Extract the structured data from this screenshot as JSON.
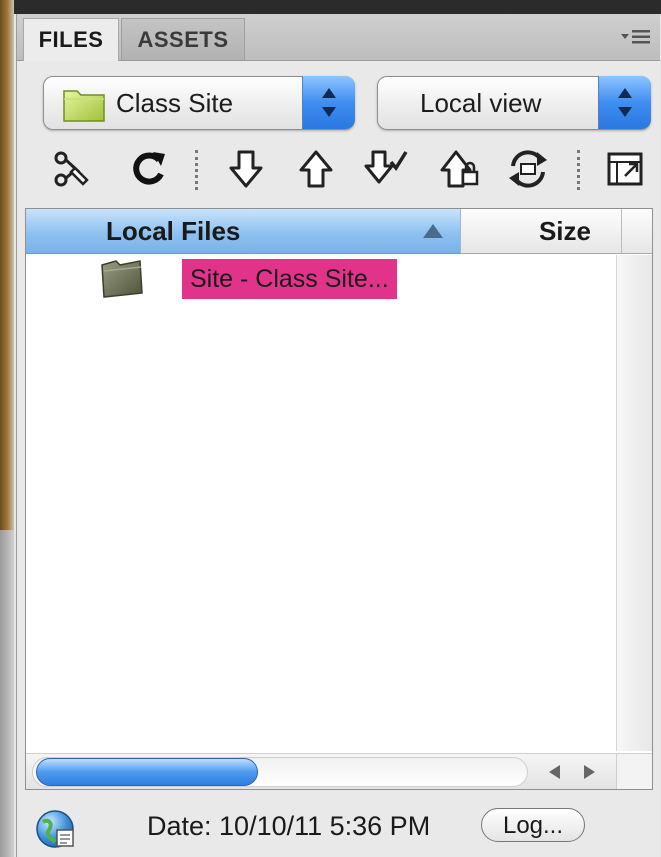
{
  "tabs": [
    {
      "label": "FILES",
      "active": true
    },
    {
      "label": "ASSETS",
      "active": false
    }
  ],
  "site_select": {
    "value": "Class Site"
  },
  "view_select": {
    "value": "Local view"
  },
  "toolbar": {
    "icons": [
      "connect-icon",
      "refresh-icon",
      "get-files-icon",
      "put-files-icon",
      "check-out-icon",
      "check-in-icon",
      "synchronize-icon",
      "expand-icon"
    ]
  },
  "filelist": {
    "columns": [
      "Local Files",
      "Size"
    ],
    "rows": [
      {
        "name": "Site - Class Site...",
        "selected": true
      }
    ]
  },
  "status": {
    "text": "Date: 10/10/11 5:36 PM",
    "log_label": "Log..."
  },
  "colors": {
    "selection": "#e2338a",
    "header_active": "#8ec1f0",
    "scroll_thumb": "#4e9bf0"
  }
}
